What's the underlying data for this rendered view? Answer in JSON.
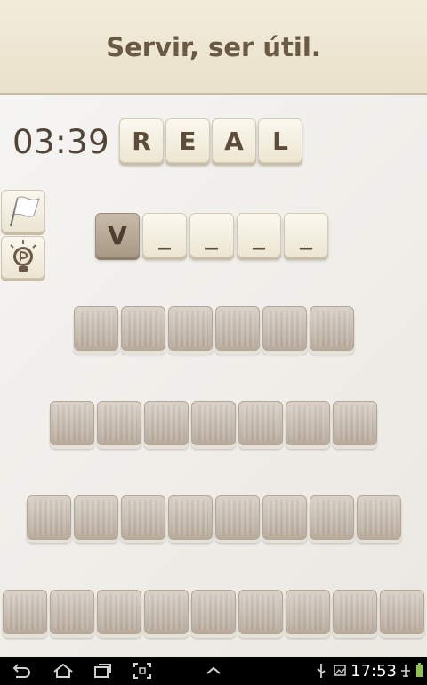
{
  "clue": {
    "text": "Servir, ser útil."
  },
  "timer": {
    "value": "03:39"
  },
  "given_word": {
    "letters": [
      "R",
      "E",
      "A",
      "L"
    ]
  },
  "answer": {
    "letters": [
      "V",
      "_",
      "_",
      "_",
      "_"
    ]
  },
  "hidden_rows": [
    {
      "tiles": 6
    },
    {
      "tiles": 7
    },
    {
      "tiles": 8
    },
    {
      "tiles": 9
    }
  ],
  "side_buttons": {
    "flag": "flag-icon",
    "hint": "lightbulb-icon"
  },
  "status_bar": {
    "time": "17:53"
  },
  "colors": {
    "header_text": "#6a5a43",
    "brown_tile": "#b3a491",
    "light_tile": "#f5f0e1"
  }
}
